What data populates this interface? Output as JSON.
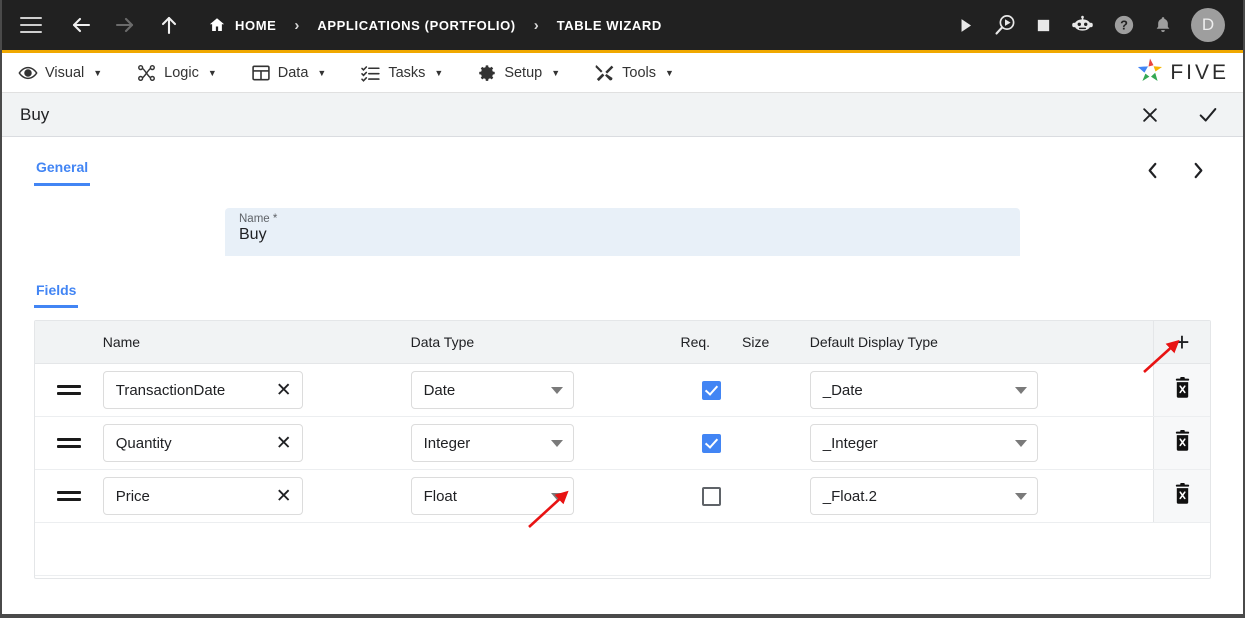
{
  "topbar": {
    "menu_icon": "hamburger-icon",
    "back_icon": "arrow-left-icon",
    "forward_icon": "arrow-right-icon",
    "up_icon": "arrow-up-icon",
    "breadcrumbs": [
      {
        "label": "HOME",
        "icon": "home-icon"
      },
      {
        "label": "APPLICATIONS (PORTFOLIO)",
        "icon": ""
      },
      {
        "label": "TABLE WIZARD",
        "icon": ""
      }
    ],
    "separator": "›",
    "actions": [
      {
        "name": "run-icon",
        "glyph": "▶"
      },
      {
        "name": "debug-icon",
        "glyph": ""
      },
      {
        "name": "stop-icon",
        "glyph": "■"
      },
      {
        "name": "bot-icon",
        "glyph": ""
      },
      {
        "name": "help-icon",
        "glyph": "?"
      },
      {
        "name": "notifications-bell-icon",
        "glyph": ""
      }
    ],
    "avatar_initial": "D",
    "background": "#212121"
  },
  "menubar": {
    "accent_color": "#f0a800",
    "items": [
      {
        "label": "Visual",
        "icon": "eye-icon",
        "caret": "▼"
      },
      {
        "label": "Logic",
        "icon": "logic-nodes-icon",
        "caret": "▼"
      },
      {
        "label": "Data",
        "icon": "table-grid-icon",
        "caret": "▼"
      },
      {
        "label": "Tasks",
        "icon": "checklist-icon",
        "caret": "▼"
      },
      {
        "label": "Setup",
        "icon": "gear-icon",
        "caret": "▼"
      },
      {
        "label": "Tools",
        "icon": "tools-icon",
        "caret": "▼"
      }
    ],
    "brand": "FIVE"
  },
  "subheader": {
    "title": "Buy",
    "close_label": "✕",
    "confirm_label": "✓"
  },
  "form": {
    "tab_label": "General",
    "prev_label": "‹",
    "next_label": "›",
    "name_label": "Name *",
    "name_value": "Buy",
    "accent_blue": "#4285f4"
  },
  "fields_section": {
    "tab_label": "Fields",
    "add_button": "+",
    "columns": [
      "",
      "Name",
      "Data Type",
      "Req.",
      "Size",
      "Default Display Type",
      ""
    ],
    "rows": [
      {
        "drag": "drag-handle",
        "name": "TransactionDate",
        "data_type": "Date",
        "required": true,
        "size": "",
        "default_display_type": "_Date",
        "delete": "delete-row"
      },
      {
        "drag": "drag-handle",
        "name": "Quantity",
        "data_type": "Integer",
        "required": true,
        "size": "",
        "default_display_type": "_Integer",
        "delete": "delete-row"
      },
      {
        "drag": "drag-handle",
        "name": "Price",
        "data_type": "Float",
        "required": false,
        "size": "",
        "default_display_type": "_Float.2",
        "delete": "delete-row"
      }
    ],
    "clear_icon": "✕"
  },
  "annotations": {
    "arrow_color": "#e81313",
    "arrow_add_button": "points-to-add-field-button",
    "arrow_float_dropdown": "points-to-float-data-type-dropdown"
  }
}
